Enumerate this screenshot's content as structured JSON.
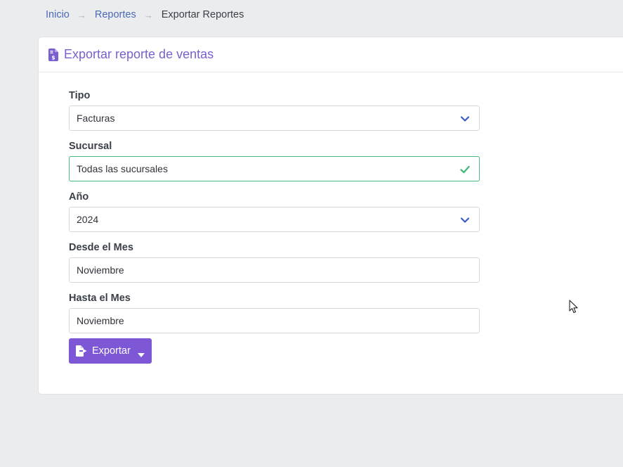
{
  "breadcrumb": {
    "items": [
      "Inicio",
      "Reportes"
    ],
    "separator": "→",
    "current": "Exportar Reportes"
  },
  "card": {
    "title": "Exportar reporte de ventas",
    "icon": "file-invoice-dollar-icon"
  },
  "form": {
    "tipo": {
      "label": "Tipo",
      "value": "Facturas"
    },
    "sucursal": {
      "label": "Sucursal",
      "value": "Todas las sucursales",
      "state": "valid"
    },
    "anio": {
      "label": "Año",
      "value": "2024"
    },
    "desde": {
      "label": "Desde el Mes",
      "value": "Noviembre"
    },
    "hasta": {
      "label": "Hasta el Mes",
      "value": "Noviembre"
    }
  },
  "export_button": {
    "label": "Exportar",
    "icon": "file-export-icon"
  },
  "colors": {
    "accent": "#7d57d6",
    "link": "#4a69b5",
    "valid": "#48b97d",
    "chevron": "#3b5cc4"
  }
}
